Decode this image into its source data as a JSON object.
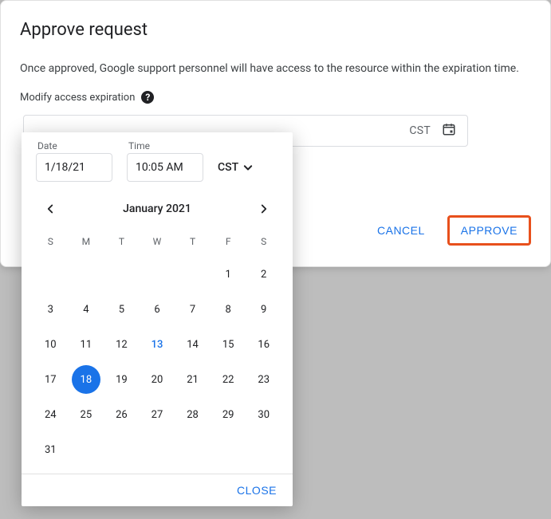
{
  "dialog": {
    "title": "Approve request",
    "body": "Once approved, Google support personnel will have access to the resource within the expiration time.",
    "expiration_label": "Modify access expiration",
    "readonly_field": {
      "tz": "CST"
    },
    "actions": {
      "cancel": "CANCEL",
      "approve": "APPROVE"
    }
  },
  "picker": {
    "date": {
      "label": "Date",
      "value": "1/18/21"
    },
    "time": {
      "label": "Time",
      "value": "10:05 AM"
    },
    "tz": "CST",
    "month": "January 2021",
    "dow": [
      "S",
      "M",
      "T",
      "W",
      "T",
      "F",
      "S"
    ],
    "leading_blanks": 5,
    "days": 31,
    "today": 13,
    "selected": 18,
    "close": "CLOSE"
  }
}
